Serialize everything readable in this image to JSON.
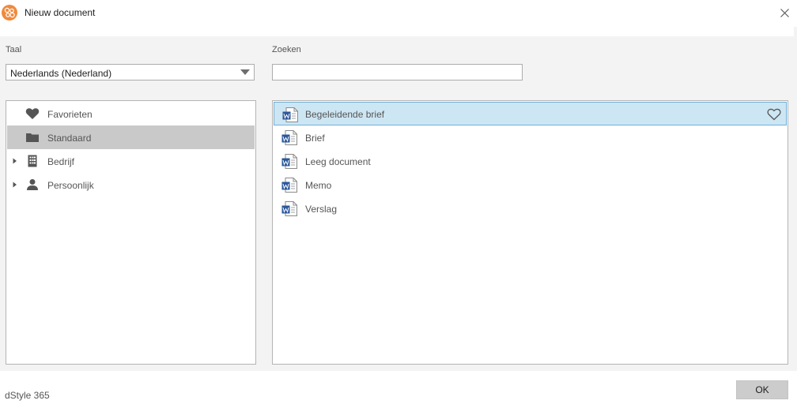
{
  "window": {
    "title": "Nieuw document",
    "icon": "dstyle-logo-icon",
    "close_icon": "close-icon"
  },
  "language": {
    "label": "Taal",
    "selected": "Nederlands (Nederland)"
  },
  "search": {
    "label": "Zoeken",
    "value": "",
    "placeholder": ""
  },
  "tree": {
    "items": [
      {
        "label": "Favorieten",
        "icon": "heart-icon",
        "expandable": false,
        "selected": false
      },
      {
        "label": "Standaard",
        "icon": "folder-icon",
        "expandable": false,
        "selected": true
      },
      {
        "label": "Bedrijf",
        "icon": "building-icon",
        "expandable": true,
        "selected": false
      },
      {
        "label": "Persoonlijk",
        "icon": "person-icon",
        "expandable": true,
        "selected": false
      }
    ]
  },
  "templates": {
    "icon": "word-document-icon",
    "items": [
      {
        "label": "Begeleidende brief",
        "selected": true,
        "favorite_icon": "heart-outline-icon"
      },
      {
        "label": "Brief",
        "selected": false
      },
      {
        "label": "Leeg document",
        "selected": false
      },
      {
        "label": "Memo",
        "selected": false
      },
      {
        "label": "Verslag",
        "selected": false
      }
    ]
  },
  "footer": {
    "brand": "dStyle 365",
    "ok_label": "OK"
  },
  "colors": {
    "brand_orange": "#f08a3c",
    "selection_blue": "#cde6f3",
    "selection_border": "#6fb0d9",
    "tree_selected": "#c9c9c9",
    "word_blue": "#2b579a"
  }
}
